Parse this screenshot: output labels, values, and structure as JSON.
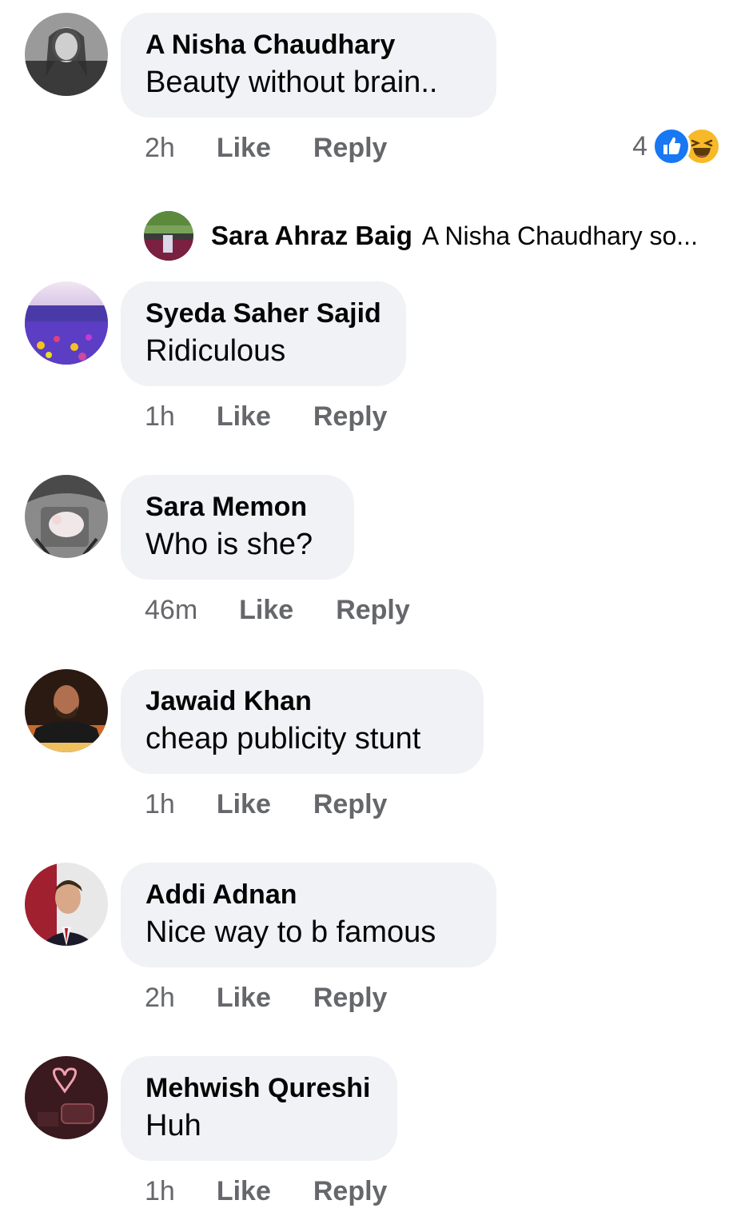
{
  "comments": [
    {
      "author": "A Nisha Chaudhary",
      "text": "Beauty without brain..",
      "time": "2h",
      "like": "Like",
      "reply": "Reply",
      "reaction_count": "4",
      "reactions": [
        "like-icon",
        "haha-icon"
      ],
      "reply_preview": {
        "author": "Sara Ahraz Baig",
        "text": "A Nisha Chaudhary so..."
      }
    },
    {
      "author": "Syeda Saher Sajid",
      "text": "Ridiculous",
      "time": "1h",
      "like": "Like",
      "reply": "Reply"
    },
    {
      "author": "Sara Memon",
      "text": "Who is she?",
      "time": "46m",
      "like": "Like",
      "reply": "Reply"
    },
    {
      "author": "Jawaid Khan",
      "text": "cheap publicity stunt",
      "time": "1h",
      "like": "Like",
      "reply": "Reply"
    },
    {
      "author": "Addi Adnan",
      "text": "Nice way to b famous",
      "time": "2h",
      "like": "Like",
      "reply": "Reply"
    },
    {
      "author": "Mehwish Qureshi",
      "text": "Huh",
      "time": "1h",
      "like": "Like",
      "reply": "Reply"
    }
  ],
  "colors": {
    "bubble": "#f0f2f5",
    "secondary_text": "#65676b",
    "primary_text": "#050505",
    "like_blue": "#1877f2",
    "haha_yellow": "#f7b928"
  }
}
